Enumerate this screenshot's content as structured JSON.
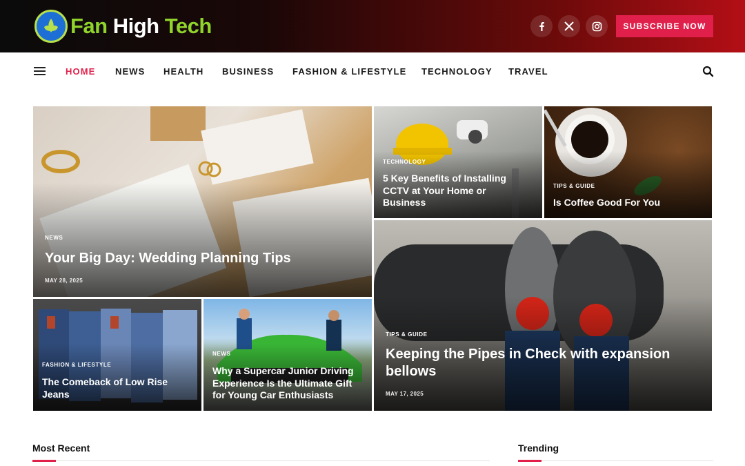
{
  "brand": {
    "part1": "Fan ",
    "part2": "High ",
    "part3": "Tech",
    "logo_icon": "globe-leaf-icon",
    "colors": {
      "green": "#8fd32b",
      "accent": "#e0204b"
    }
  },
  "header": {
    "social": [
      {
        "name": "facebook-icon",
        "glyph": "f"
      },
      {
        "name": "x-icon",
        "glyph": "𝕏"
      },
      {
        "name": "instagram-icon",
        "glyph": "◎"
      }
    ],
    "subscribe_label": "SUBSCRIBE NOW"
  },
  "nav": {
    "items": [
      "HOME",
      "NEWS",
      "HEALTH",
      "BUSINESS",
      "FASHION & LIFESTYLE",
      "TECHNOLOGY",
      "TRAVEL"
    ],
    "active": "HOME"
  },
  "featured": [
    {
      "category": "NEWS",
      "title": "Your Big Day: Wedding Planning Tips",
      "date": "MAY 28, 2025"
    },
    {
      "category": "TECHNOLOGY",
      "title": "5 Key Benefits of Installing CCTV at Your Home or Business"
    },
    {
      "category": "TIPS & GUIDE",
      "title": "Is Coffee Good For You"
    },
    {
      "category": "TIPS & GUIDE",
      "title": "Keeping the Pipes in Check with expansion bellows",
      "date": "MAY 17, 2025"
    },
    {
      "category": "FASHION & LIFESTYLE",
      "title": "The Comeback of Low Rise Jeans"
    },
    {
      "category": "NEWS",
      "title": "Why a Supercar Junior Driving Experience Is the Ultimate Gift for Young Car Enthusiasts"
    }
  ],
  "sections": {
    "recent": "Most Recent",
    "trending": "Trending"
  }
}
